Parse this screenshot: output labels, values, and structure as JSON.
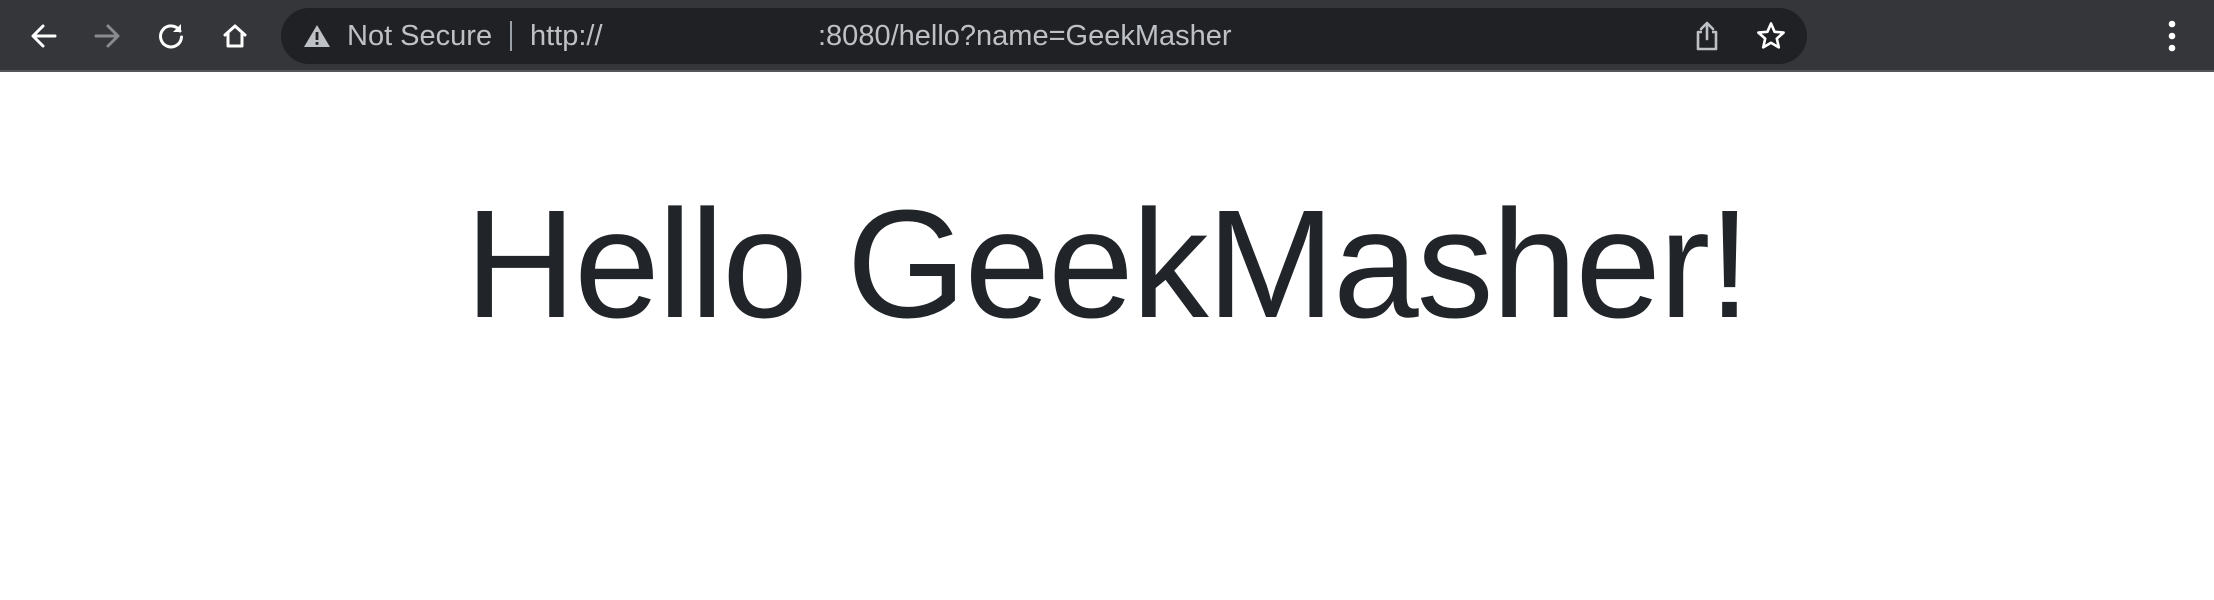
{
  "browser": {
    "security_label": "Not Secure",
    "url_scheme": "http://",
    "url_rest": ":8080/hello?name=GeekMasher",
    "icons": {
      "back": "back-arrow-icon",
      "forward": "forward-arrow-icon",
      "reload": "reload-icon",
      "home": "home-icon",
      "security": "warning-triangle-icon",
      "share": "share-icon",
      "bookmark": "star-icon",
      "menu": "kebab-menu-icon"
    },
    "colors": {
      "toolbar": "#35363a",
      "omnibox": "#202124",
      "omnibox_text": "#bdc1c6",
      "forward_disabled": "#8a8b8e"
    }
  },
  "page": {
    "heading": "Hello GeekMasher!",
    "heading_color": "#212529"
  }
}
